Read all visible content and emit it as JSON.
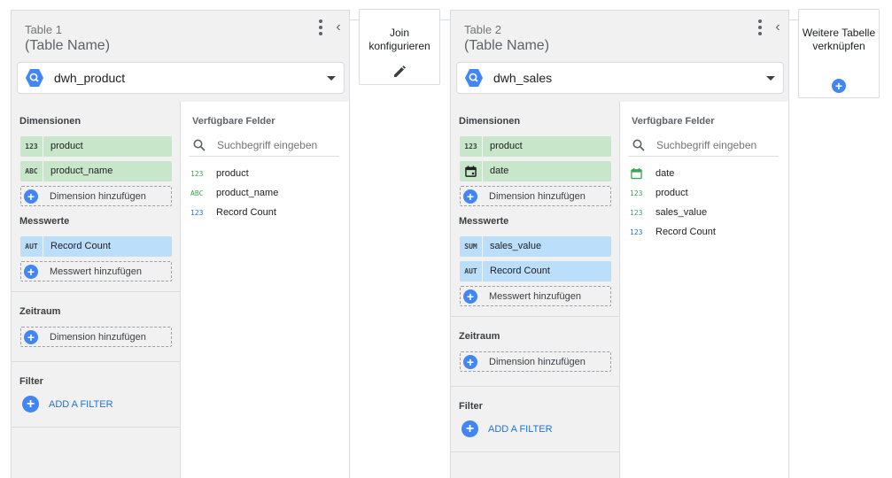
{
  "join": {
    "label": "Join konfigurieren",
    "icon": "pencil-icon"
  },
  "add_table": {
    "label": "Weitere Tabelle verknüpfen",
    "icon": "plus-icon"
  },
  "colors": {
    "accent": "#4285f4",
    "dimension_chip": "#c8e6c9",
    "metric_chip": "#bbdefb",
    "link": "#1a73e8"
  },
  "section_labels": {
    "dimensions": "Dimensionen",
    "metrics": "Messwerte",
    "date_range": "Zeitraum",
    "filter": "Filter",
    "available_fields": "Verfügbare Felder",
    "add_dimension": "Dimension hinzufügen",
    "add_metric": "Messwert hinzufügen",
    "add_filter": "ADD A FILTER"
  },
  "tables": [
    {
      "title": "Table 1",
      "name": "(Table Name)",
      "source": "dwh_product",
      "dimensions": [
        {
          "type": "123",
          "label": "product"
        },
        {
          "type": "ABC",
          "label": "product_name"
        }
      ],
      "metrics": [
        {
          "type": "AUT",
          "label": "Record Count"
        }
      ],
      "search_placeholder": "Suchbegriff eingeben",
      "fields": [
        {
          "type": "123",
          "label": "product"
        },
        {
          "type": "ABC",
          "label": "product_name"
        },
        {
          "type": "123",
          "label": "Record Count"
        }
      ]
    },
    {
      "title": "Table 2",
      "name": "(Table Name)",
      "source": "dwh_sales",
      "dimensions": [
        {
          "type": "123",
          "label": "product"
        },
        {
          "type": "calendar-icon",
          "label": "date"
        }
      ],
      "metrics": [
        {
          "type": "SUM",
          "label": "sales_value"
        },
        {
          "type": "AUT",
          "label": "Record Count"
        }
      ],
      "search_placeholder": "Suchbegriff eingeben",
      "fields": [
        {
          "type": "calendar-icon",
          "label": "date"
        },
        {
          "type": "123",
          "label": "product"
        },
        {
          "type": "123",
          "label": "sales_value"
        },
        {
          "type": "123",
          "label": "Record Count"
        }
      ]
    }
  ]
}
